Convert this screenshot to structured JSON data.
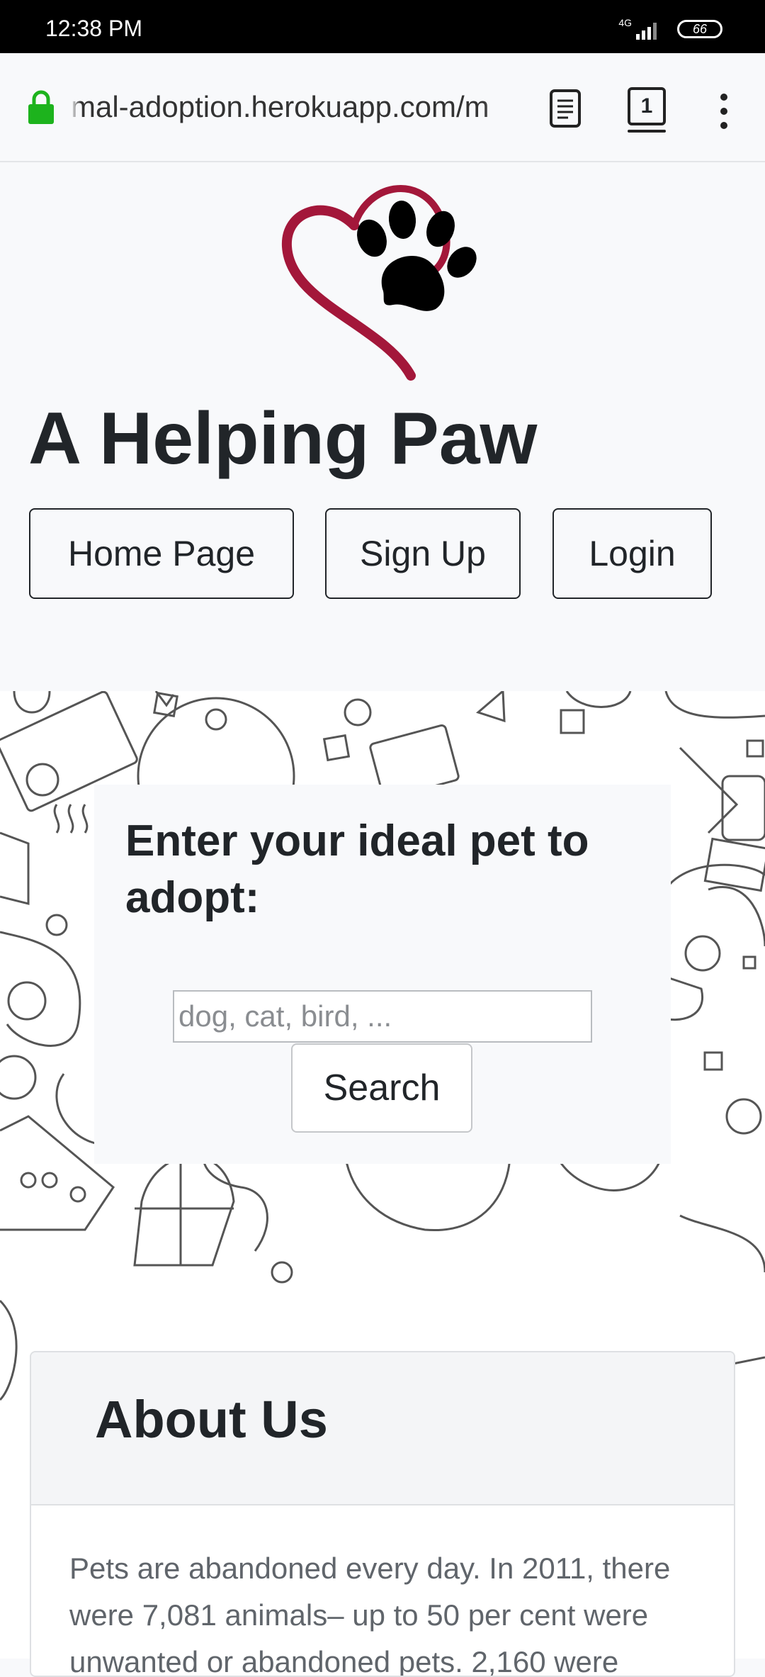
{
  "status_bar": {
    "time": "12:38 PM",
    "network": "4G",
    "battery": "66"
  },
  "browser": {
    "url": "mal-adoption.herokuapp.com/m",
    "tab_count": "1"
  },
  "header": {
    "site_title": "A Helping Paw",
    "nav": {
      "home": "Home Page",
      "signup": "Sign Up",
      "login": "Login"
    }
  },
  "search": {
    "heading": "Enter your ideal pet to adopt:",
    "placeholder": "dog, cat, bird, ...",
    "button": "Search"
  },
  "about": {
    "title": "About Us",
    "text": "Pets are abandoned every day. In 2011, there were 7,081 animals– up to 50 per cent were unwanted or abandoned pets. 2,160 were"
  },
  "colors": {
    "heart": "#a3173a",
    "lock": "#1db31d",
    "page_bg": "#f8f9fb"
  }
}
